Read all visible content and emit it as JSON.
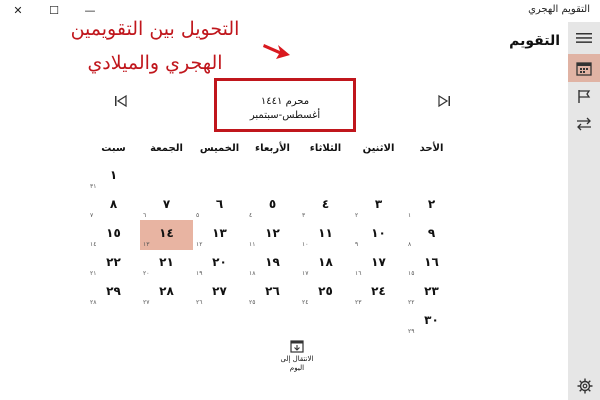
{
  "app": {
    "title": "التقويم الهجري",
    "window_controls": {
      "close": "✕",
      "maximize": "☐",
      "minimize": "—"
    }
  },
  "annotation": {
    "line1": "التحويل بين التقويمين",
    "line2": "الهجري والميلادي",
    "color": "#c0161c"
  },
  "header": {
    "page_title": "التقويم"
  },
  "nav": {
    "items": [
      {
        "name": "menu-icon",
        "active": false
      },
      {
        "name": "calendar-icon",
        "active": true
      },
      {
        "name": "flag-icon",
        "active": false
      },
      {
        "name": "swap-arrows-icon",
        "active": false
      }
    ],
    "settings_icon": "gear-icon"
  },
  "month": {
    "hijri": "محرم ١٤٤١",
    "gregorian": "أغسطس-سبتمبر",
    "prev_icon": "skip-previous-icon",
    "next_icon": "skip-next-icon"
  },
  "weekdays": [
    "الأحد",
    "الاثنين",
    "الثلاثاء",
    "الأربعاء",
    "الخميس",
    "الجمعة",
    "سبت"
  ],
  "days": [
    {
      "hijri": "١",
      "greg": "٣١"
    },
    {
      "hijri": "٢",
      "greg": "١"
    },
    {
      "hijri": "٣",
      "greg": "٢"
    },
    {
      "hijri": "٤",
      "greg": "٣"
    },
    {
      "hijri": "٥",
      "greg": "٤"
    },
    {
      "hijri": "٦",
      "greg": "٥"
    },
    {
      "hijri": "٧",
      "greg": "٦"
    },
    {
      "hijri": "٨",
      "greg": "٧"
    },
    {
      "hijri": "٩",
      "greg": "٨"
    },
    {
      "hijri": "١٠",
      "greg": "٩"
    },
    {
      "hijri": "١١",
      "greg": "١٠"
    },
    {
      "hijri": "١٢",
      "greg": "١١"
    },
    {
      "hijri": "١٣",
      "greg": "١٢"
    },
    {
      "hijri": "١٤",
      "greg": "١٣",
      "today": true
    },
    {
      "hijri": "١٥",
      "greg": "١٤"
    },
    {
      "hijri": "١٦",
      "greg": "١٥"
    },
    {
      "hijri": "١٧",
      "greg": "١٦"
    },
    {
      "hijri": "١٨",
      "greg": "١٧"
    },
    {
      "hijri": "١٩",
      "greg": "١٨"
    },
    {
      "hijri": "٢٠",
      "greg": "١٩"
    },
    {
      "hijri": "٢١",
      "greg": "٢٠"
    },
    {
      "hijri": "٢٢",
      "greg": "٢١"
    },
    {
      "hijri": "٢٣",
      "greg": "٢٢"
    },
    {
      "hijri": "٢٤",
      "greg": "٢٣"
    },
    {
      "hijri": "٢٥",
      "greg": "٢٤"
    },
    {
      "hijri": "٢٦",
      "greg": "٢٥"
    },
    {
      "hijri": "٢٧",
      "greg": "٢٦"
    },
    {
      "hijri": "٢٨",
      "greg": "٢٧"
    },
    {
      "hijri": "٢٩",
      "greg": "٢٨"
    },
    {
      "hijri": "٣٠",
      "greg": "٢٩"
    }
  ],
  "first_day_column": 6,
  "goto_today": {
    "label_line1": "الانتقال إلى",
    "label_line2": "اليوم",
    "icon": "calendar-today-icon"
  },
  "colors": {
    "today_bg": "#e8b4a2",
    "rail_bg": "#e6e6e6",
    "rail_active": "#e0b3a4"
  }
}
